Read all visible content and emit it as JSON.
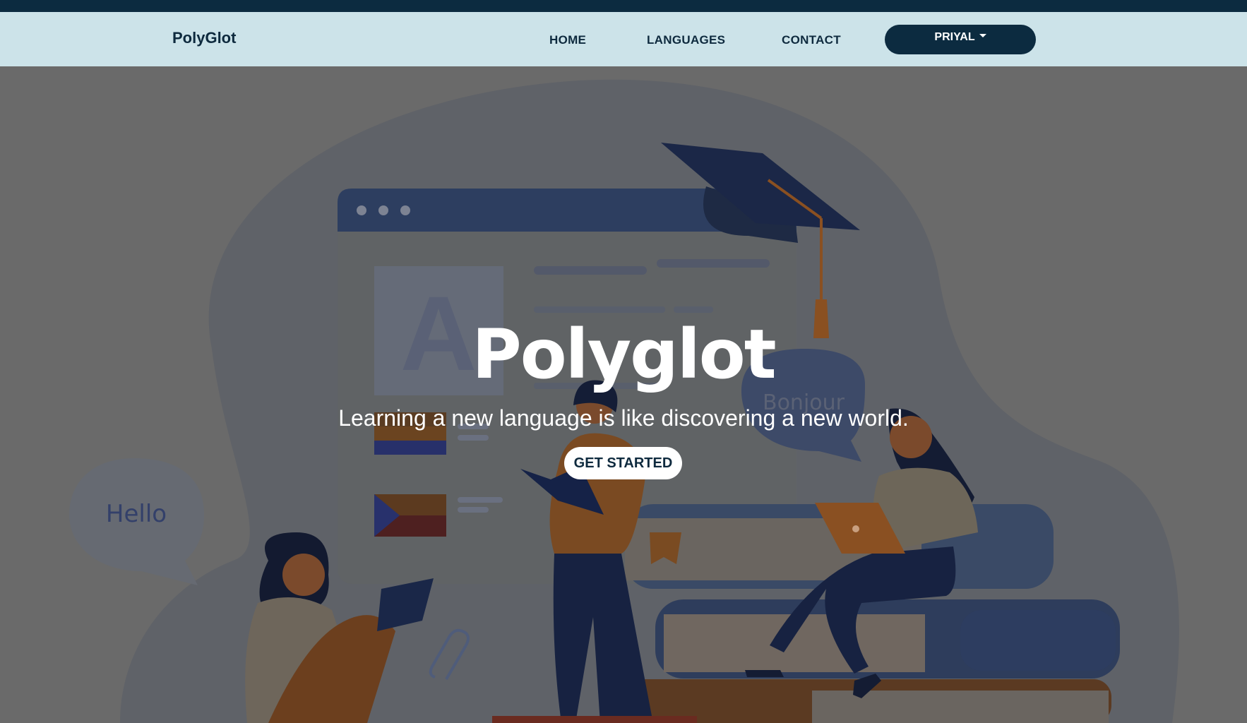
{
  "navbar": {
    "brand": "PolyGlot",
    "links": [
      "HOME",
      "LANGUAGES",
      "CONTACT"
    ],
    "user_label": "PRIYAL"
  },
  "hero": {
    "title": "Polyglot",
    "subtitle": "Learning a new language is like discovering a new world.",
    "cta_label": "GET STARTED",
    "illustration": {
      "card_letter": "A",
      "bubble_left": "Hello",
      "bubble_right": "Bonjour"
    }
  },
  "colors": {
    "top_strip": "#0c2b40",
    "navbar_bg": "#cce3e9",
    "hero_overlay": "#6a6a6a",
    "accent_dark": "#0c2b40"
  },
  "icons": [
    "caret-down-icon",
    "graduation-cap-icon",
    "laptop-icon",
    "book-icon",
    "paperclip-icon",
    "flag-icon",
    "speech-bubble-icon"
  ]
}
